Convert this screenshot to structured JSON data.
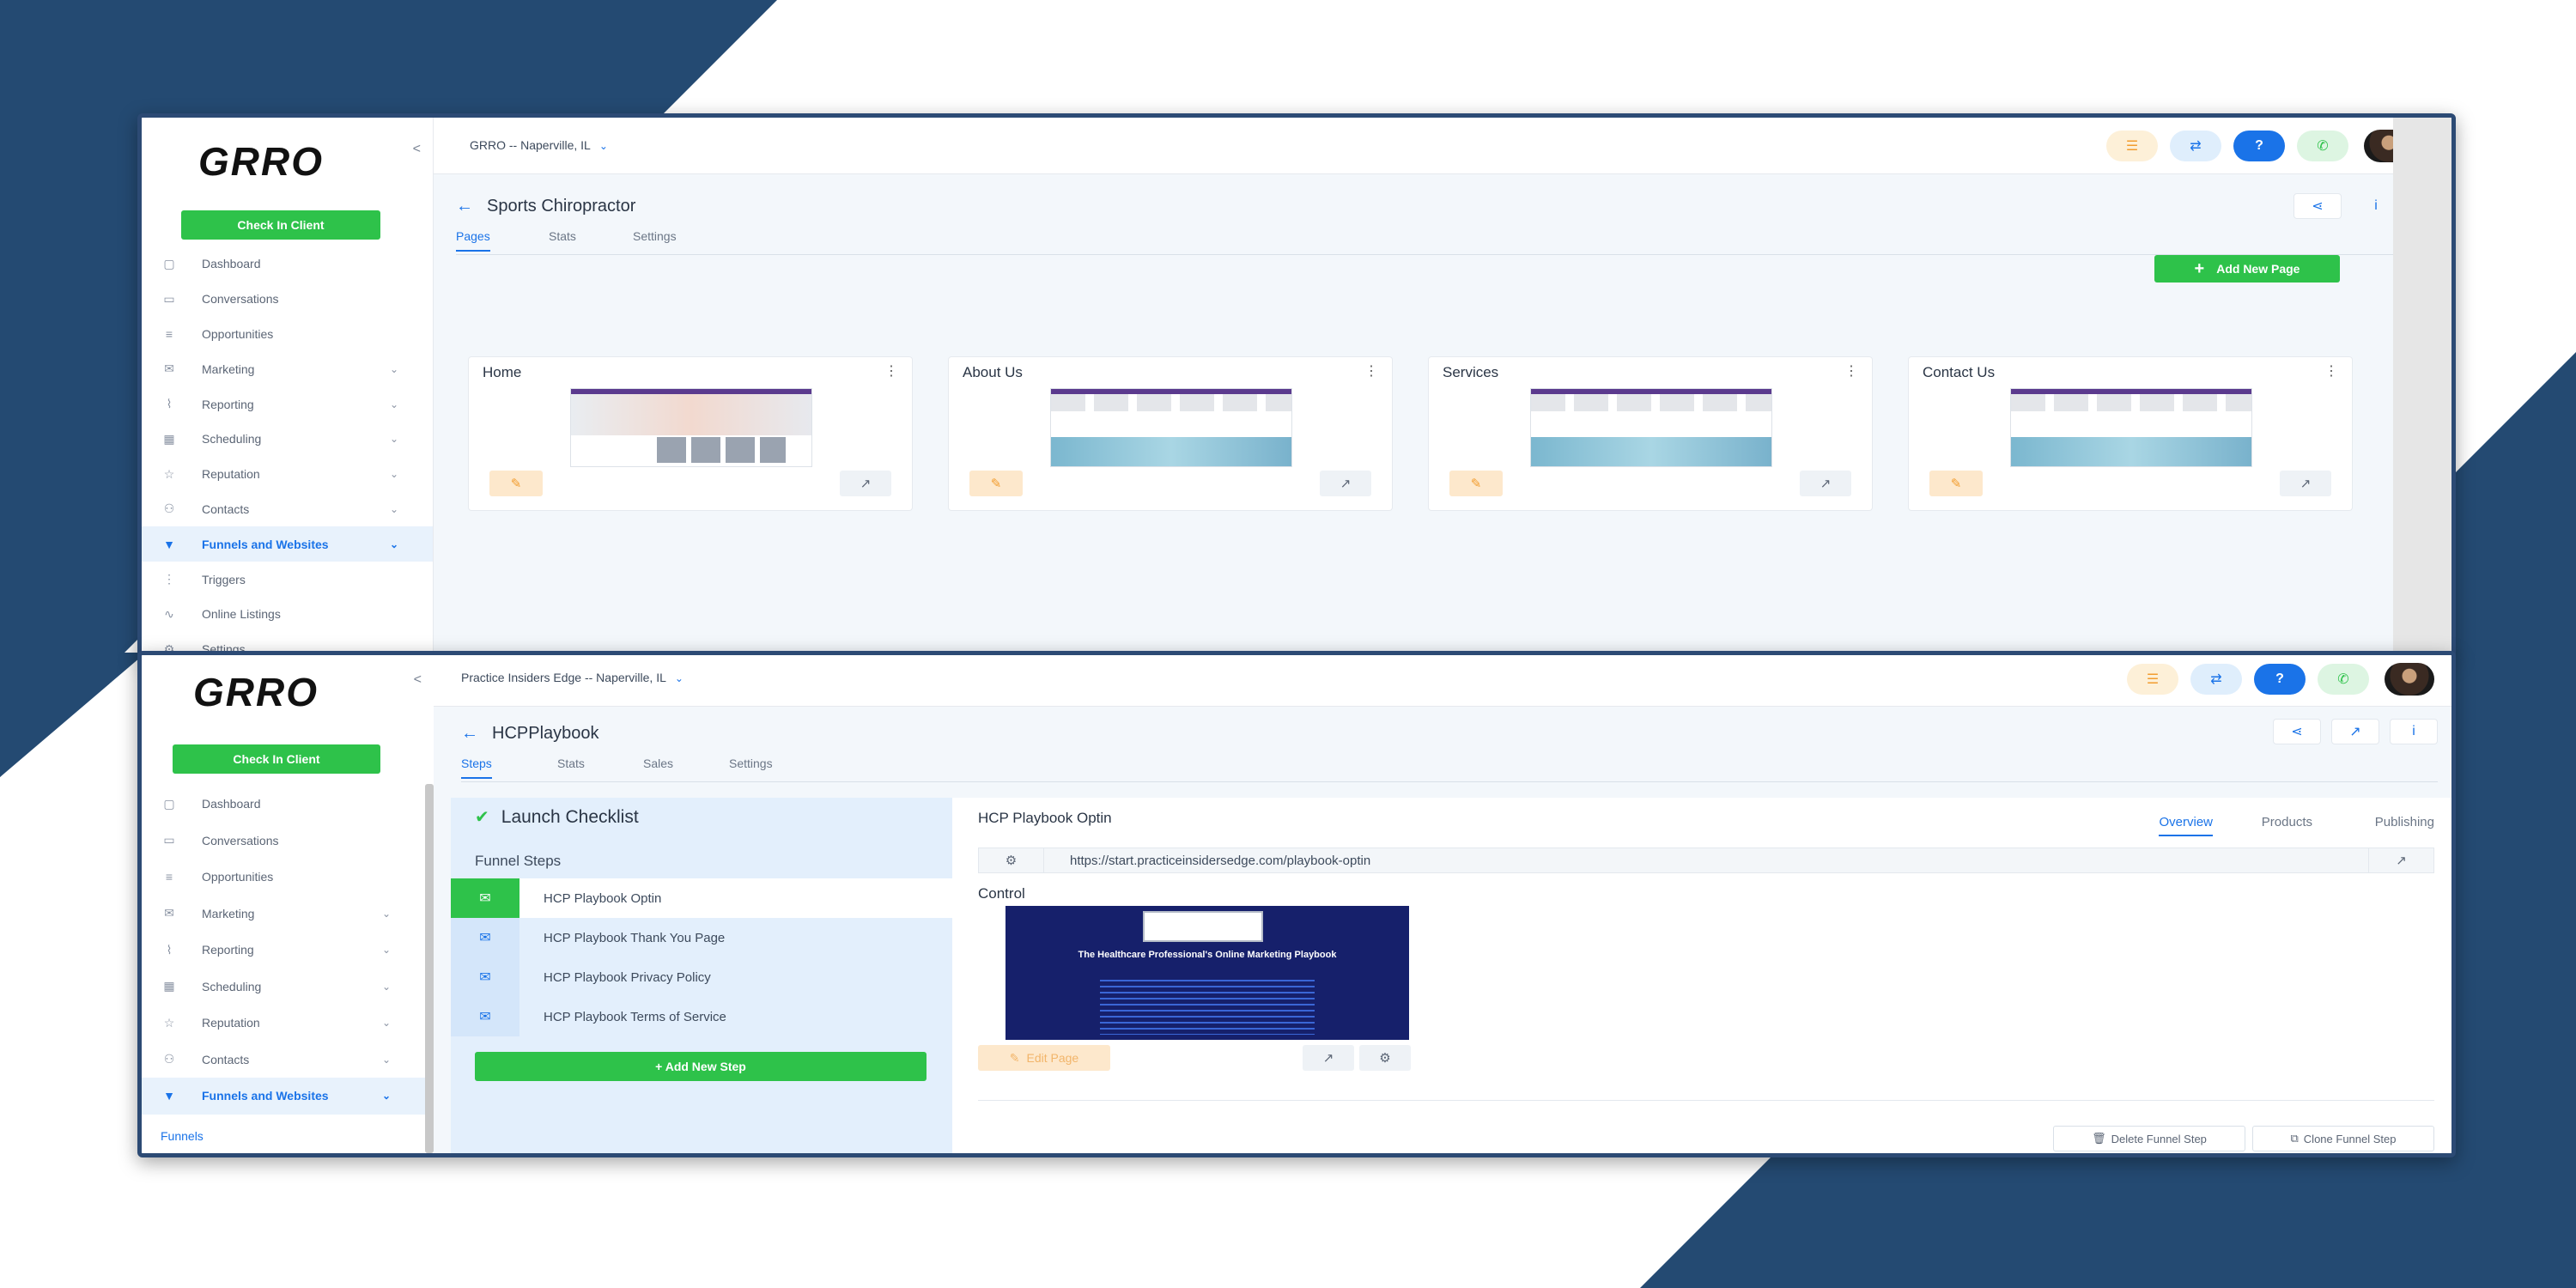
{
  "colors": {
    "brand_green": "#2ec24a",
    "accent_blue": "#1a73e8",
    "navy": "#244a72"
  },
  "window1": {
    "logo": "GRRO",
    "check_in": "Check In Client",
    "location": "GRRO -- Naperville, IL",
    "nav": [
      {
        "label": "Dashboard",
        "icon": "dashboard-icon"
      },
      {
        "label": "Conversations",
        "icon": "chat-icon"
      },
      {
        "label": "Opportunities",
        "icon": "layers-icon"
      },
      {
        "label": "Marketing",
        "icon": "mail-icon",
        "chevron": true
      },
      {
        "label": "Reporting",
        "icon": "chart-icon",
        "chevron": true
      },
      {
        "label": "Scheduling",
        "icon": "calendar-icon",
        "chevron": true
      },
      {
        "label": "Reputation",
        "icon": "star-icon",
        "chevron": true
      },
      {
        "label": "Contacts",
        "icon": "user-icon",
        "chevron": true
      },
      {
        "label": "Funnels and Websites",
        "icon": "filter-icon",
        "chevron": true,
        "active": true
      },
      {
        "label": "Triggers",
        "icon": "trigger-icon"
      },
      {
        "label": "Online Listings",
        "icon": "pulse-icon"
      },
      {
        "label": "Settings",
        "icon": "gear-icon"
      }
    ],
    "page_title": "Sports Chiropractor",
    "tabs": [
      "Pages",
      "Stats",
      "Settings"
    ],
    "add_page": "Add New Page",
    "cards": [
      "Home",
      "About Us",
      "Services",
      "Contact Us"
    ]
  },
  "window2": {
    "logo": "GRRO",
    "check_in": "Check In Client",
    "location": "Practice Insiders Edge -- Naperville, IL",
    "nav": [
      {
        "label": "Dashboard",
        "icon": "dashboard-icon"
      },
      {
        "label": "Conversations",
        "icon": "chat-icon"
      },
      {
        "label": "Opportunities",
        "icon": "layers-icon"
      },
      {
        "label": "Marketing",
        "icon": "mail-icon",
        "chevron": true
      },
      {
        "label": "Reporting",
        "icon": "chart-icon",
        "chevron": true
      },
      {
        "label": "Scheduling",
        "icon": "calendar-icon",
        "chevron": true
      },
      {
        "label": "Reputation",
        "icon": "star-icon",
        "chevron": true
      },
      {
        "label": "Contacts",
        "icon": "user-icon",
        "chevron": true
      },
      {
        "label": "Funnels and Websites",
        "icon": "filter-icon",
        "chevron": true,
        "active": true
      }
    ],
    "funnels_sub": "Funnels",
    "page_title": "HCPPlaybook",
    "tabs": [
      "Steps",
      "Stats",
      "Sales",
      "Settings"
    ],
    "launch_checklist": "Launch Checklist",
    "funnel_steps": "Funnel Steps",
    "steps": [
      "HCP Playbook Optin",
      "HCP Playbook Thank You Page",
      "HCP Playbook Privacy Policy",
      "HCP Playbook Terms of Service"
    ],
    "add_step": "+ Add New Step",
    "step_header": "HCP Playbook Optin",
    "right_tabs": [
      "Overview",
      "Products",
      "Publishing"
    ],
    "url": "https://start.practiceinsidersedge.com/playbook-optin",
    "control": "Control",
    "preview_title": "The Healthcare Professional's Online Marketing Playbook",
    "edit_page": "Edit Page",
    "delete_step": "Delete Funnel Step",
    "clone_step": "Clone Funnel Step"
  }
}
